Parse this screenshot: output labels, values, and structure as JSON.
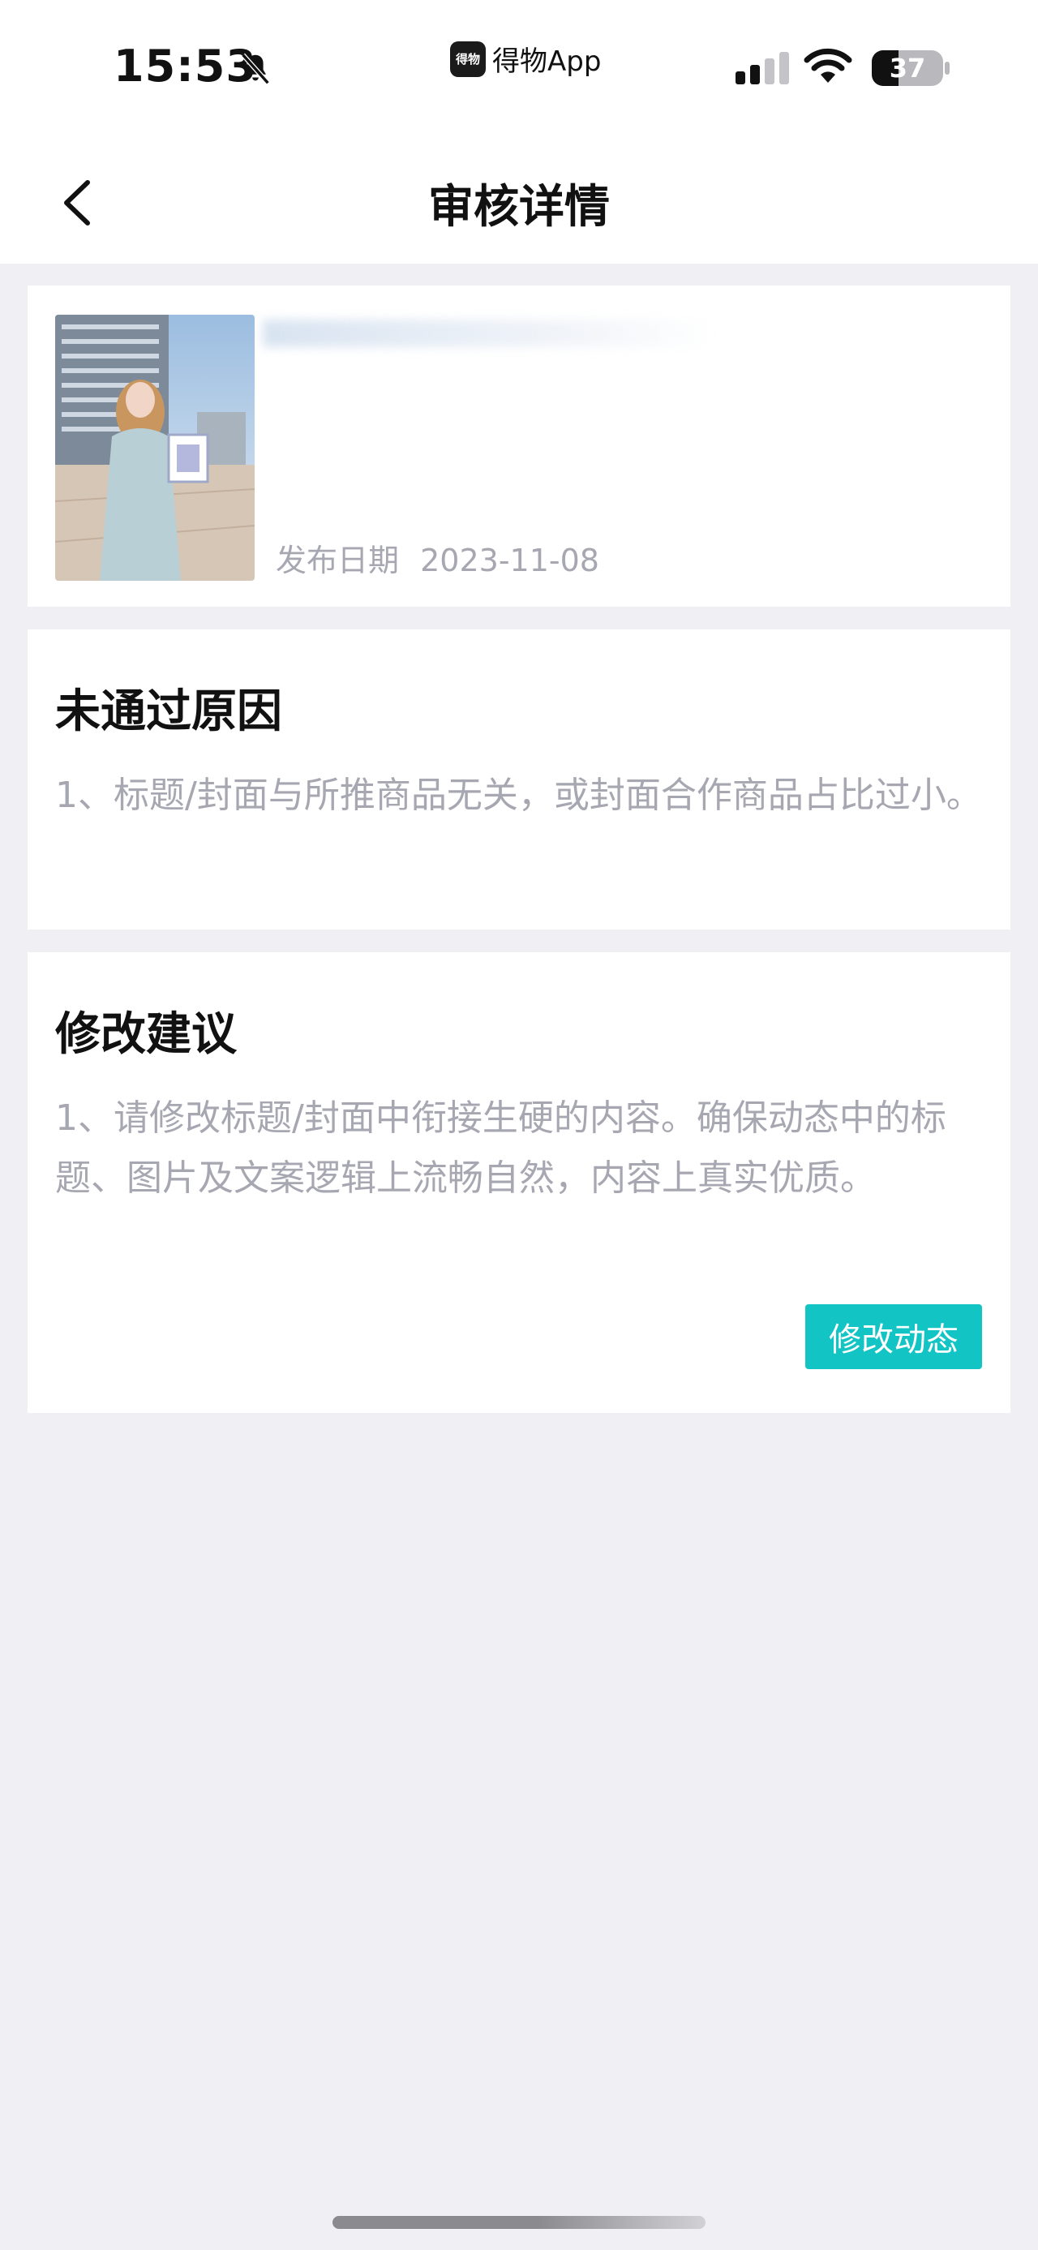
{
  "status_bar": {
    "time": "15:53",
    "app_name": "得物App",
    "app_icon_text": "得物",
    "battery": "37",
    "battery_level": 0.37
  },
  "nav": {
    "title": "审核详情",
    "back_icon": "chevron-left-icon"
  },
  "post": {
    "date_label": "发布日期",
    "date": "2023-11-08"
  },
  "reason": {
    "title": "未通过原因",
    "text": "1、标题/封面与所推商品无关，或封面合作商品占比过小。"
  },
  "suggestion": {
    "title": "修改建议",
    "text": "1、请修改标题/封面中衔接生硬的内容。确保动态中的标题、图片及文案逻辑上流畅自然，内容上真实优质。",
    "button": "修改动态"
  },
  "colors": {
    "accent": "#13c4c4",
    "muted_text": "#a7a7b2",
    "background": "#efeff4"
  }
}
